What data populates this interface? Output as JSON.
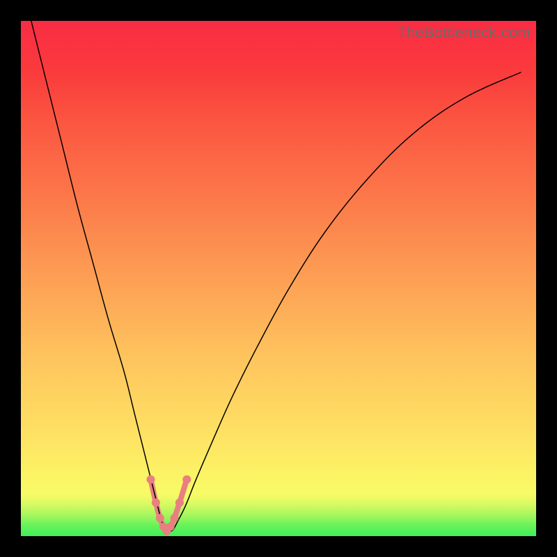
{
  "watermark": "TheBottleneck.com",
  "chart_data": {
    "type": "line",
    "title": "",
    "xlabel": "",
    "ylabel": "",
    "xlim": [
      0,
      100
    ],
    "ylim": [
      0,
      100
    ],
    "grid": false,
    "legend": false,
    "annotations": [],
    "series": [
      {
        "name": "bottleneck-curve",
        "x": [
          2,
          5,
          8,
          11,
          14,
          17,
          20,
          22,
          24,
          25.5,
          26.5,
          27.3,
          28,
          28.7,
          29.5,
          30.5,
          32,
          34,
          37,
          41,
          46,
          52,
          59,
          67,
          76,
          86,
          97
        ],
        "y": [
          100,
          88,
          76,
          64,
          53,
          42,
          32,
          24,
          16,
          10,
          6,
          3,
          1.2,
          1.0,
          1.2,
          3,
          6,
          11,
          18,
          27,
          37,
          48,
          59,
          69,
          78,
          85,
          90
        ]
      }
    ],
    "markers": {
      "name": "highlighted-points",
      "x": [
        25.2,
        26.2,
        27.0,
        27.7,
        28.3,
        29.0,
        29.8,
        30.8,
        32.2
      ],
      "y": [
        11.0,
        6.5,
        3.5,
        1.8,
        1.0,
        1.8,
        3.5,
        6.5,
        11.0
      ]
    }
  }
}
